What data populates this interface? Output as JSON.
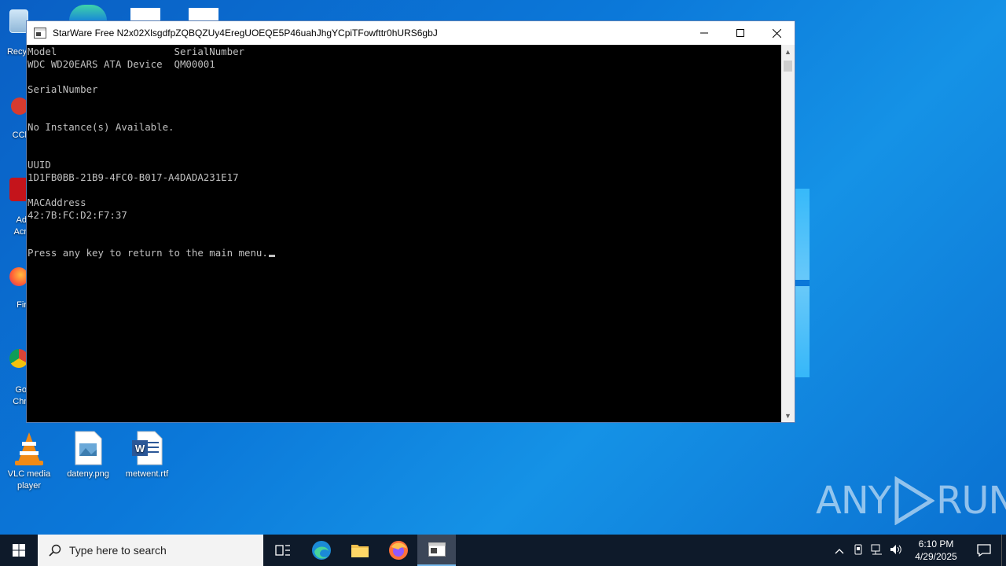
{
  "window": {
    "title": "StarWare Free N2x02XlsgdfpZQBQZUy4EregUOEQE5P46uahJhgYCpiTFowfttr0hURS6gbJ",
    "console_lines": [
      "Model                    SerialNumber",
      "WDC WD20EARS ATA Device  QM00001",
      "",
      "SerialNumber",
      "",
      "",
      "No Instance(s) Available.",
      "",
      "",
      "UUID",
      "1D1FB0BB-21B9-4FC0-B017-A4DADA231E17",
      "",
      "MACAddress",
      "42:7B:FC:D2:F7:37",
      "",
      "",
      "Press any key to return to the main menu."
    ]
  },
  "desktop": {
    "left_stubs": [
      "Recy",
      "CCl",
      "Ad",
      "Acr",
      "Fir",
      "Go",
      "Chr"
    ],
    "icons": [
      {
        "label": "VLC media player"
      },
      {
        "label": "dateny.png"
      },
      {
        "label": "metwent.rtf"
      }
    ],
    "watermark": {
      "left": "ANY",
      "right": "RUN"
    }
  },
  "taskbar": {
    "search_placeholder": "Type here to search",
    "time": "6:10 PM",
    "date": "4/29/2025"
  },
  "colors": {
    "console_bg": "#000000",
    "console_text": "#c0c0c0",
    "taskbar_bg": "#0e1a2a",
    "desktop_accent": "#0b78d9"
  }
}
